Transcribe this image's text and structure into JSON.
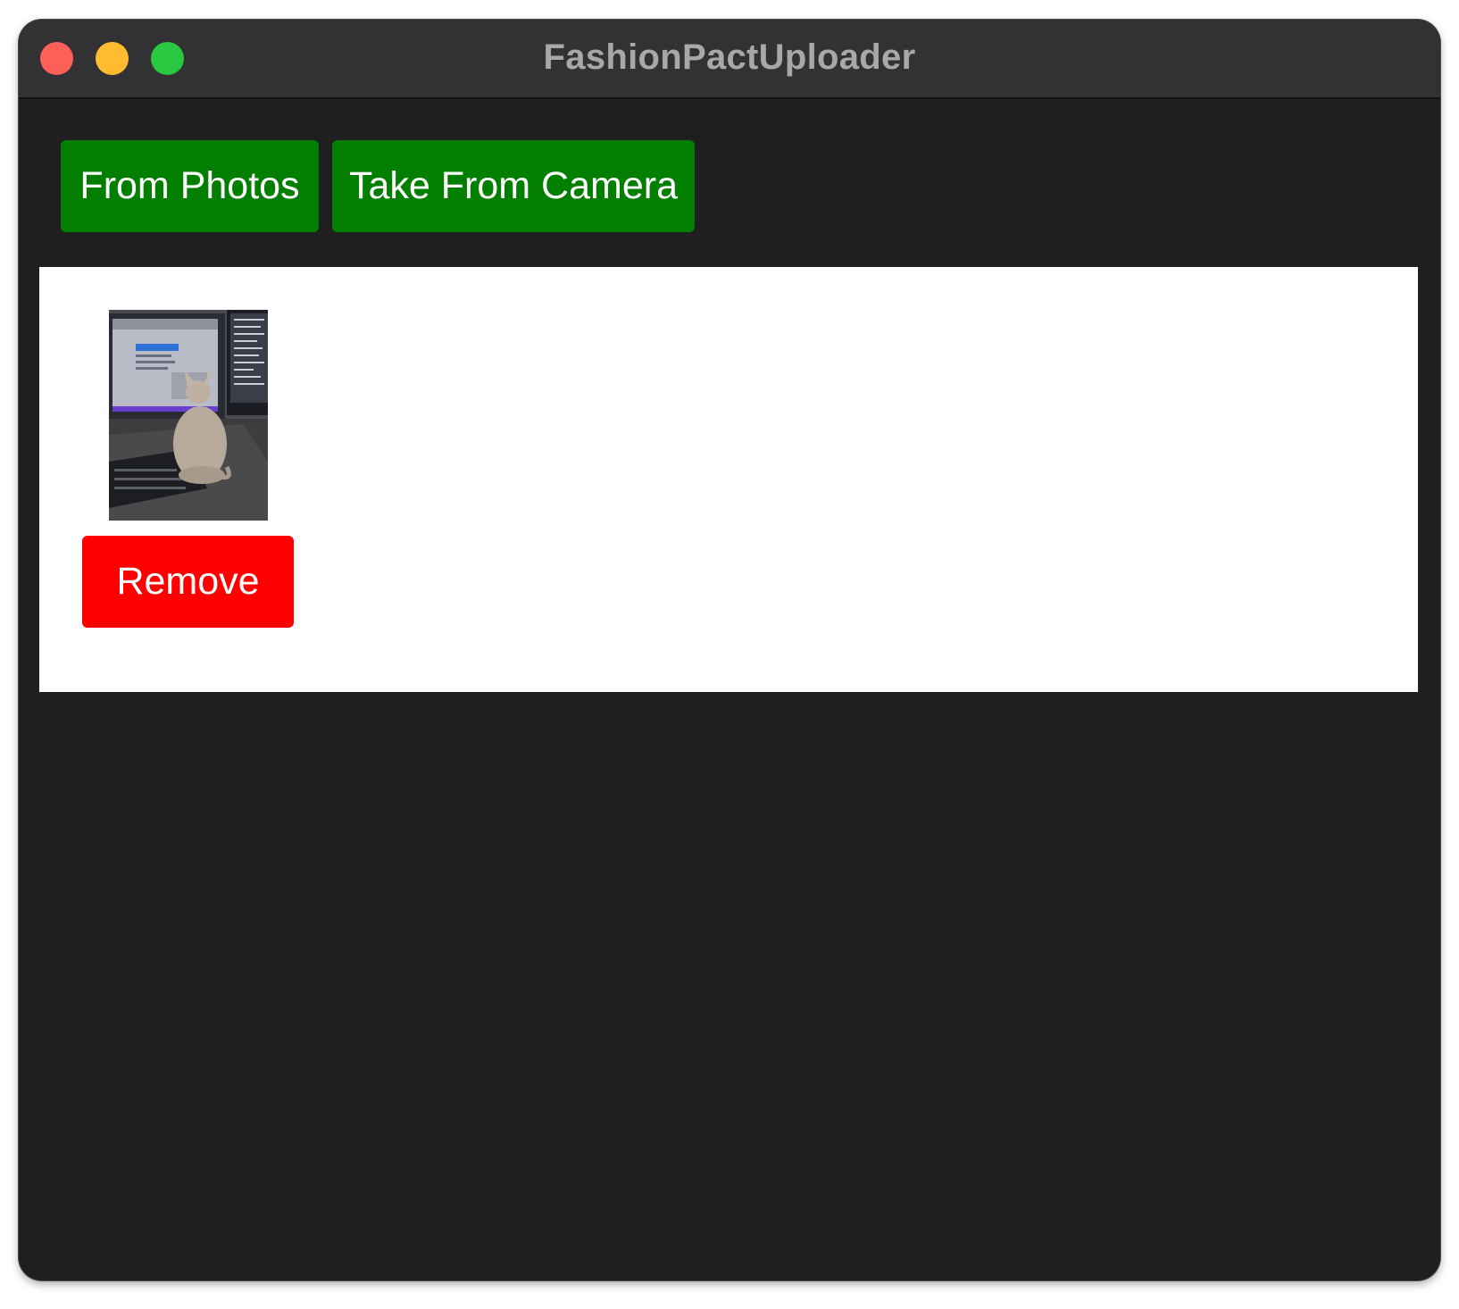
{
  "window": {
    "title": "FashionPactUploader"
  },
  "toolbar": {
    "from_photos_label": "From Photos",
    "take_from_camera_label": "Take From Camera"
  },
  "gallery": {
    "items": [
      {
        "thumbnail_icon": "photo-thumbnail",
        "remove_label": "Remove"
      }
    ]
  },
  "colors": {
    "window_bg": "#1f1f1f",
    "titlebar_bg": "#323134",
    "action_green": "#027f01",
    "remove_red": "#fe0000",
    "panel_bg": "#ffffff"
  }
}
